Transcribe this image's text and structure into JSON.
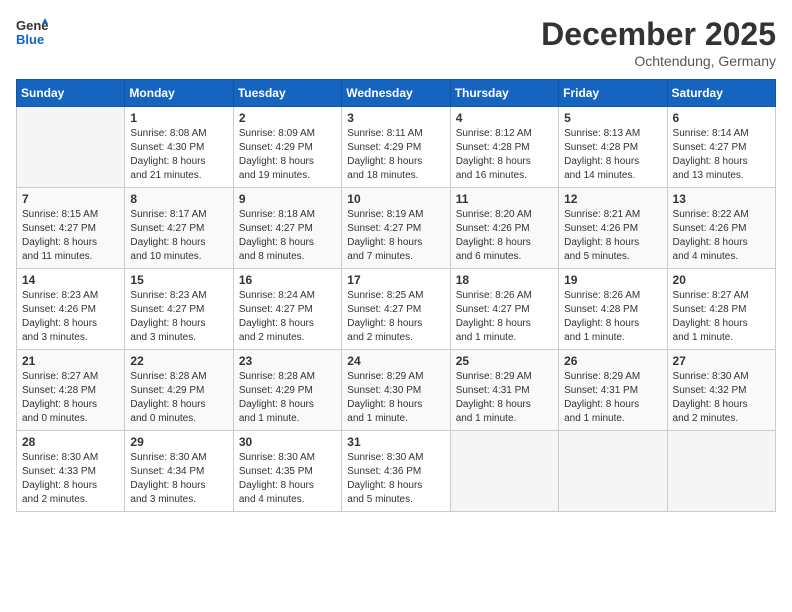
{
  "header": {
    "logo_line1": "General",
    "logo_line2": "Blue",
    "month": "December 2025",
    "location": "Ochtendung, Germany"
  },
  "days_of_week": [
    "Sunday",
    "Monday",
    "Tuesday",
    "Wednesday",
    "Thursday",
    "Friday",
    "Saturday"
  ],
  "weeks": [
    [
      {
        "day": "",
        "info": ""
      },
      {
        "day": "1",
        "info": "Sunrise: 8:08 AM\nSunset: 4:30 PM\nDaylight: 8 hours\nand 21 minutes."
      },
      {
        "day": "2",
        "info": "Sunrise: 8:09 AM\nSunset: 4:29 PM\nDaylight: 8 hours\nand 19 minutes."
      },
      {
        "day": "3",
        "info": "Sunrise: 8:11 AM\nSunset: 4:29 PM\nDaylight: 8 hours\nand 18 minutes."
      },
      {
        "day": "4",
        "info": "Sunrise: 8:12 AM\nSunset: 4:28 PM\nDaylight: 8 hours\nand 16 minutes."
      },
      {
        "day": "5",
        "info": "Sunrise: 8:13 AM\nSunset: 4:28 PM\nDaylight: 8 hours\nand 14 minutes."
      },
      {
        "day": "6",
        "info": "Sunrise: 8:14 AM\nSunset: 4:27 PM\nDaylight: 8 hours\nand 13 minutes."
      }
    ],
    [
      {
        "day": "7",
        "info": "Sunrise: 8:15 AM\nSunset: 4:27 PM\nDaylight: 8 hours\nand 11 minutes."
      },
      {
        "day": "8",
        "info": "Sunrise: 8:17 AM\nSunset: 4:27 PM\nDaylight: 8 hours\nand 10 minutes."
      },
      {
        "day": "9",
        "info": "Sunrise: 8:18 AM\nSunset: 4:27 PM\nDaylight: 8 hours\nand 8 minutes."
      },
      {
        "day": "10",
        "info": "Sunrise: 8:19 AM\nSunset: 4:27 PM\nDaylight: 8 hours\nand 7 minutes."
      },
      {
        "day": "11",
        "info": "Sunrise: 8:20 AM\nSunset: 4:26 PM\nDaylight: 8 hours\nand 6 minutes."
      },
      {
        "day": "12",
        "info": "Sunrise: 8:21 AM\nSunset: 4:26 PM\nDaylight: 8 hours\nand 5 minutes."
      },
      {
        "day": "13",
        "info": "Sunrise: 8:22 AM\nSunset: 4:26 PM\nDaylight: 8 hours\nand 4 minutes."
      }
    ],
    [
      {
        "day": "14",
        "info": "Sunrise: 8:23 AM\nSunset: 4:26 PM\nDaylight: 8 hours\nand 3 minutes."
      },
      {
        "day": "15",
        "info": "Sunrise: 8:23 AM\nSunset: 4:27 PM\nDaylight: 8 hours\nand 3 minutes."
      },
      {
        "day": "16",
        "info": "Sunrise: 8:24 AM\nSunset: 4:27 PM\nDaylight: 8 hours\nand 2 minutes."
      },
      {
        "day": "17",
        "info": "Sunrise: 8:25 AM\nSunset: 4:27 PM\nDaylight: 8 hours\nand 2 minutes."
      },
      {
        "day": "18",
        "info": "Sunrise: 8:26 AM\nSunset: 4:27 PM\nDaylight: 8 hours\nand 1 minute."
      },
      {
        "day": "19",
        "info": "Sunrise: 8:26 AM\nSunset: 4:28 PM\nDaylight: 8 hours\nand 1 minute."
      },
      {
        "day": "20",
        "info": "Sunrise: 8:27 AM\nSunset: 4:28 PM\nDaylight: 8 hours\nand 1 minute."
      }
    ],
    [
      {
        "day": "21",
        "info": "Sunrise: 8:27 AM\nSunset: 4:28 PM\nDaylight: 8 hours\nand 0 minutes."
      },
      {
        "day": "22",
        "info": "Sunrise: 8:28 AM\nSunset: 4:29 PM\nDaylight: 8 hours\nand 0 minutes."
      },
      {
        "day": "23",
        "info": "Sunrise: 8:28 AM\nSunset: 4:29 PM\nDaylight: 8 hours\nand 1 minute."
      },
      {
        "day": "24",
        "info": "Sunrise: 8:29 AM\nSunset: 4:30 PM\nDaylight: 8 hours\nand 1 minute."
      },
      {
        "day": "25",
        "info": "Sunrise: 8:29 AM\nSunset: 4:31 PM\nDaylight: 8 hours\nand 1 minute."
      },
      {
        "day": "26",
        "info": "Sunrise: 8:29 AM\nSunset: 4:31 PM\nDaylight: 8 hours\nand 1 minute."
      },
      {
        "day": "27",
        "info": "Sunrise: 8:30 AM\nSunset: 4:32 PM\nDaylight: 8 hours\nand 2 minutes."
      }
    ],
    [
      {
        "day": "28",
        "info": "Sunrise: 8:30 AM\nSunset: 4:33 PM\nDaylight: 8 hours\nand 2 minutes."
      },
      {
        "day": "29",
        "info": "Sunrise: 8:30 AM\nSunset: 4:34 PM\nDaylight: 8 hours\nand 3 minutes."
      },
      {
        "day": "30",
        "info": "Sunrise: 8:30 AM\nSunset: 4:35 PM\nDaylight: 8 hours\nand 4 minutes."
      },
      {
        "day": "31",
        "info": "Sunrise: 8:30 AM\nSunset: 4:36 PM\nDaylight: 8 hours\nand 5 minutes."
      },
      {
        "day": "",
        "info": ""
      },
      {
        "day": "",
        "info": ""
      },
      {
        "day": "",
        "info": ""
      }
    ]
  ]
}
